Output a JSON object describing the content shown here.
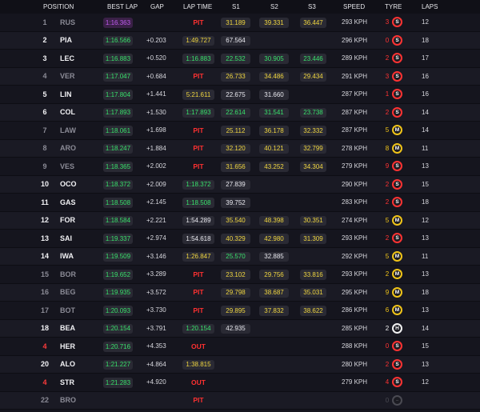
{
  "header": {
    "position": "POSITION",
    "best_lap": "BEST LAP",
    "gap": "GAP",
    "lap_time": "LAP TIME",
    "s1": "S1",
    "s2": "S2",
    "s3": "S3",
    "speed": "SPEED",
    "tyre": "TYRE",
    "laps": "LAPS"
  },
  "colors": {
    "green": "#39e06b",
    "purple": "#c05df0",
    "yellow": "#f0d640",
    "red": "#ff3131",
    "soft": "#ff3333",
    "medium": "#f0c419",
    "hard": "#f2f2f2"
  },
  "rows": [
    {
      "pos": "1",
      "pos_red": false,
      "driver": "RUS",
      "dim": true,
      "best_lap": "1:16.363",
      "best_color": "purple",
      "gap": "",
      "lap_time": "PIT",
      "lap_type": "pit",
      "s1": "31.189",
      "s1c": "yellow",
      "s2": "39.331",
      "s2c": "yellow",
      "s3": "36.447",
      "s3c": "yellow",
      "speed": "293 KPH",
      "tyre_count": "3",
      "tyre_count_color": "red",
      "tyre": "S",
      "tyre_type": "soft",
      "laps": "12"
    },
    {
      "pos": "2",
      "pos_red": false,
      "driver": "PIA",
      "dim": false,
      "best_lap": "1:16.566",
      "best_color": "green",
      "gap": "+0.203",
      "lap_time": "1:49.727",
      "lap_type": "yellow",
      "s1": "67.564",
      "s1c": "white",
      "s2": "",
      "s2c": "",
      "s3": "",
      "s3c": "",
      "speed": "296 KPH",
      "tyre_count": "0",
      "tyre_count_color": "red",
      "tyre": "S",
      "tyre_type": "soft",
      "laps": "18"
    },
    {
      "pos": "3",
      "pos_red": false,
      "driver": "LEC",
      "dim": false,
      "best_lap": "1:16.883",
      "best_color": "green",
      "gap": "+0.520",
      "lap_time": "1:16.883",
      "lap_type": "green",
      "s1": "22.532",
      "s1c": "green",
      "s2": "30.905",
      "s2c": "green",
      "s3": "23.446",
      "s3c": "green",
      "speed": "289 KPH",
      "tyre_count": "2",
      "tyre_count_color": "red",
      "tyre": "S",
      "tyre_type": "soft",
      "laps": "17"
    },
    {
      "pos": "4",
      "pos_red": false,
      "driver": "VER",
      "dim": true,
      "best_lap": "1:17.047",
      "best_color": "green",
      "gap": "+0.684",
      "lap_time": "PIT",
      "lap_type": "pit",
      "s1": "26.733",
      "s1c": "yellow",
      "s2": "34.486",
      "s2c": "yellow",
      "s3": "29.434",
      "s3c": "yellow",
      "speed": "291 KPH",
      "tyre_count": "3",
      "tyre_count_color": "red",
      "tyre": "S",
      "tyre_type": "soft",
      "laps": "16"
    },
    {
      "pos": "5",
      "pos_red": false,
      "driver": "LIN",
      "dim": false,
      "best_lap": "1:17.804",
      "best_color": "green",
      "gap": "+1.441",
      "lap_time": "5:21.611",
      "lap_type": "yellow",
      "s1": "22.675",
      "s1c": "white",
      "s2": "31.660",
      "s2c": "white",
      "s3": "",
      "s3c": "",
      "speed": "287 KPH",
      "tyre_count": "1",
      "tyre_count_color": "red",
      "tyre": "S",
      "tyre_type": "soft",
      "laps": "16"
    },
    {
      "pos": "6",
      "pos_red": false,
      "driver": "COL",
      "dim": false,
      "best_lap": "1:17.893",
      "best_color": "green",
      "gap": "+1.530",
      "lap_time": "1:17.893",
      "lap_type": "green",
      "s1": "22.614",
      "s1c": "green",
      "s2": "31.541",
      "s2c": "green",
      "s3": "23.738",
      "s3c": "green",
      "speed": "287 KPH",
      "tyre_count": "2",
      "tyre_count_color": "red",
      "tyre": "S",
      "tyre_type": "soft",
      "laps": "14"
    },
    {
      "pos": "7",
      "pos_red": false,
      "driver": "LAW",
      "dim": true,
      "best_lap": "1:18.061",
      "best_color": "green",
      "gap": "+1.698",
      "lap_time": "PIT",
      "lap_type": "pit",
      "s1": "25.112",
      "s1c": "yellow",
      "s2": "36.178",
      "s2c": "yellow",
      "s3": "32.332",
      "s3c": "yellow",
      "speed": "287 KPH",
      "tyre_count": "5",
      "tyre_count_color": "yellow",
      "tyre": "M",
      "tyre_type": "medium",
      "laps": "14"
    },
    {
      "pos": "8",
      "pos_red": false,
      "driver": "ARO",
      "dim": true,
      "best_lap": "1:18.247",
      "best_color": "green",
      "gap": "+1.884",
      "lap_time": "PIT",
      "lap_type": "pit",
      "s1": "32.120",
      "s1c": "yellow",
      "s2": "40.121",
      "s2c": "yellow",
      "s3": "32.799",
      "s3c": "yellow",
      "speed": "278 KPH",
      "tyre_count": "8",
      "tyre_count_color": "yellow",
      "tyre": "M",
      "tyre_type": "medium",
      "laps": "11"
    },
    {
      "pos": "9",
      "pos_red": false,
      "driver": "VES",
      "dim": true,
      "best_lap": "1:18.365",
      "best_color": "green",
      "gap": "+2.002",
      "lap_time": "PIT",
      "lap_type": "pit",
      "s1": "31.656",
      "s1c": "yellow",
      "s2": "43.252",
      "s2c": "yellow",
      "s3": "34.304",
      "s3c": "yellow",
      "speed": "279 KPH",
      "tyre_count": "9",
      "tyre_count_color": "red",
      "tyre": "S",
      "tyre_type": "soft",
      "laps": "13"
    },
    {
      "pos": "10",
      "pos_red": false,
      "driver": "OCO",
      "dim": false,
      "best_lap": "1:18.372",
      "best_color": "green",
      "gap": "+2.009",
      "lap_time": "1:18.372",
      "lap_type": "green",
      "s1": "27.839",
      "s1c": "white",
      "s2": "",
      "s2c": "",
      "s3": "",
      "s3c": "",
      "speed": "290 KPH",
      "tyre_count": "2",
      "tyre_count_color": "red",
      "tyre": "S",
      "tyre_type": "soft",
      "laps": "15"
    },
    {
      "pos": "11",
      "pos_red": false,
      "driver": "GAS",
      "dim": false,
      "best_lap": "1:18.508",
      "best_color": "green",
      "gap": "+2.145",
      "lap_time": "1:18.508",
      "lap_type": "green",
      "s1": "39.752",
      "s1c": "white",
      "s2": "",
      "s2c": "",
      "s3": "",
      "s3c": "",
      "speed": "283 KPH",
      "tyre_count": "2",
      "tyre_count_color": "red",
      "tyre": "S",
      "tyre_type": "soft",
      "laps": "18"
    },
    {
      "pos": "12",
      "pos_red": false,
      "driver": "FOR",
      "dim": false,
      "best_lap": "1:18.584",
      "best_color": "green",
      "gap": "+2.221",
      "lap_time": "1:54.289",
      "lap_type": "white",
      "s1": "35.540",
      "s1c": "yellow",
      "s2": "48.398",
      "s2c": "yellow",
      "s3": "30.351",
      "s3c": "yellow",
      "speed": "274 KPH",
      "tyre_count": "5",
      "tyre_count_color": "yellow",
      "tyre": "M",
      "tyre_type": "medium",
      "laps": "12"
    },
    {
      "pos": "13",
      "pos_red": false,
      "driver": "SAI",
      "dim": false,
      "best_lap": "1:19.337",
      "best_color": "green",
      "gap": "+2.974",
      "lap_time": "1:54.618",
      "lap_type": "white",
      "s1": "40.329",
      "s1c": "yellow",
      "s2": "42.980",
      "s2c": "yellow",
      "s3": "31.309",
      "s3c": "yellow",
      "speed": "293 KPH",
      "tyre_count": "2",
      "tyre_count_color": "red",
      "tyre": "S",
      "tyre_type": "soft",
      "laps": "13"
    },
    {
      "pos": "14",
      "pos_red": false,
      "driver": "IWA",
      "dim": false,
      "best_lap": "1:19.509",
      "best_color": "green",
      "gap": "+3.146",
      "lap_time": "1:26.847",
      "lap_type": "yellow",
      "s1": "25.570",
      "s1c": "green",
      "s2": "32.885",
      "s2c": "white",
      "s3": "",
      "s3c": "",
      "speed": "292 KPH",
      "tyre_count": "5",
      "tyre_count_color": "yellow",
      "tyre": "M",
      "tyre_type": "medium",
      "laps": "11"
    },
    {
      "pos": "15",
      "pos_red": false,
      "driver": "BOR",
      "dim": true,
      "best_lap": "1:19.652",
      "best_color": "green",
      "gap": "+3.289",
      "lap_time": "PIT",
      "lap_type": "pit",
      "s1": "23.102",
      "s1c": "yellow",
      "s2": "29.756",
      "s2c": "yellow",
      "s3": "33.816",
      "s3c": "yellow",
      "speed": "293 KPH",
      "tyre_count": "2",
      "tyre_count_color": "yellow",
      "tyre": "M",
      "tyre_type": "medium",
      "laps": "13"
    },
    {
      "pos": "16",
      "pos_red": false,
      "driver": "BEG",
      "dim": true,
      "best_lap": "1:19.935",
      "best_color": "green",
      "gap": "+3.572",
      "lap_time": "PIT",
      "lap_type": "pit",
      "s1": "29.798",
      "s1c": "yellow",
      "s2": "38.687",
      "s2c": "yellow",
      "s3": "35.031",
      "s3c": "yellow",
      "speed": "295 KPH",
      "tyre_count": "9",
      "tyre_count_color": "yellow",
      "tyre": "M",
      "tyre_type": "medium",
      "laps": "18"
    },
    {
      "pos": "17",
      "pos_red": false,
      "driver": "BOT",
      "dim": true,
      "best_lap": "1:20.093",
      "best_color": "green",
      "gap": "+3.730",
      "lap_time": "PIT",
      "lap_type": "pit",
      "s1": "29.895",
      "s1c": "yellow",
      "s2": "37.832",
      "s2c": "yellow",
      "s3": "38.622",
      "s3c": "yellow",
      "speed": "286 KPH",
      "tyre_count": "6",
      "tyre_count_color": "yellow",
      "tyre": "M",
      "tyre_type": "medium",
      "laps": "13"
    },
    {
      "pos": "18",
      "pos_red": false,
      "driver": "BEA",
      "dim": false,
      "best_lap": "1:20.154",
      "best_color": "green",
      "gap": "+3.791",
      "lap_time": "1:20.154",
      "lap_type": "green",
      "s1": "42.935",
      "s1c": "white",
      "s2": "",
      "s2c": "",
      "s3": "",
      "s3c": "",
      "speed": "285 KPH",
      "tyre_count": "2",
      "tyre_count_color": "white",
      "tyre": "H",
      "tyre_type": "hard",
      "laps": "14"
    },
    {
      "pos": "4",
      "pos_red": true,
      "driver": "HER",
      "dim": false,
      "best_lap": "1:20.716",
      "best_color": "green",
      "gap": "+4.353",
      "lap_time": "OUT",
      "lap_type": "out",
      "s1": "",
      "s1c": "",
      "s2": "",
      "s2c": "",
      "s3": "",
      "s3c": "",
      "speed": "288 KPH",
      "tyre_count": "0",
      "tyre_count_color": "red",
      "tyre": "S",
      "tyre_type": "soft",
      "laps": "15"
    },
    {
      "pos": "20",
      "pos_red": false,
      "driver": "ALO",
      "dim": false,
      "best_lap": "1:21.227",
      "best_color": "green",
      "gap": "+4.864",
      "lap_time": "1:38.815",
      "lap_type": "yellow",
      "s1": "",
      "s1c": "",
      "s2": "",
      "s2c": "",
      "s3": "",
      "s3c": "",
      "speed": "280 KPH",
      "tyre_count": "2",
      "tyre_count_color": "red",
      "tyre": "S",
      "tyre_type": "soft",
      "laps": "13"
    },
    {
      "pos": "4",
      "pos_red": true,
      "driver": "STR",
      "dim": false,
      "best_lap": "1:21.283",
      "best_color": "green",
      "gap": "+4.920",
      "lap_time": "OUT",
      "lap_type": "out",
      "s1": "",
      "s1c": "",
      "s2": "",
      "s2c": "",
      "s3": "",
      "s3c": "",
      "speed": "279 KPH",
      "tyre_count": "4",
      "tyre_count_color": "red",
      "tyre": "S",
      "tyre_type": "soft",
      "laps": "12"
    },
    {
      "pos": "22",
      "pos_red": false,
      "driver": "BRO",
      "dim": true,
      "best_lap": "",
      "best_color": "",
      "gap": "",
      "lap_time": "PIT",
      "lap_type": "pit",
      "s1": "",
      "s1c": "",
      "s2": "",
      "s2c": "",
      "s3": "",
      "s3c": "",
      "speed": "",
      "tyre_count": "0",
      "tyre_count_color": "grey",
      "tyre": "–",
      "tyre_type": "none",
      "laps": ""
    }
  ]
}
